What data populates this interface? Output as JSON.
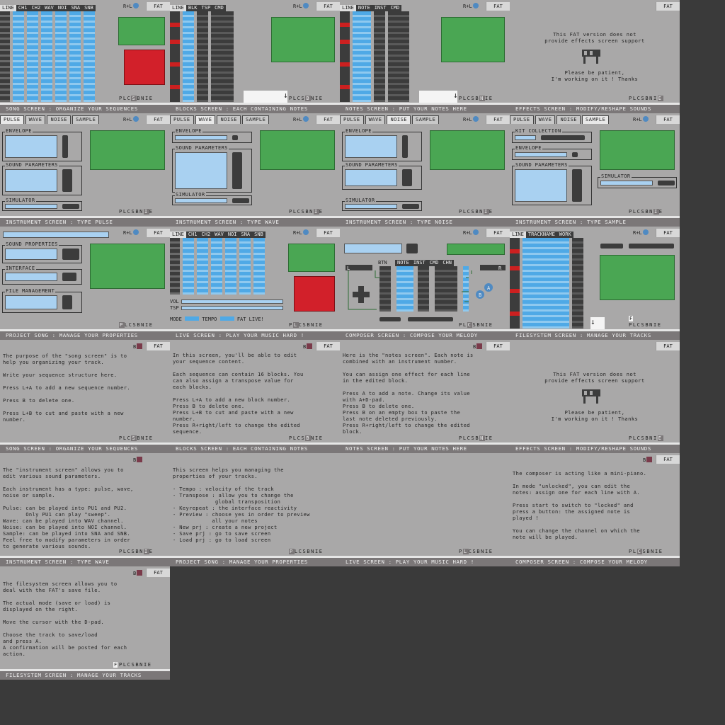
{
  "common": {
    "rl_label": "R+L",
    "b_label": "B",
    "fat_label": "FAT",
    "nav_letters": "PLCSBNIE",
    "nav_chars": [
      "P",
      "L",
      "C",
      "S",
      "B",
      "N",
      "I",
      "E"
    ]
  },
  "captions": {
    "song": "Song screen : organize your sequences",
    "blocks": "Blocks screen : each containing notes",
    "notes": "Notes screen : put your notes here",
    "effects": "Effects screen : modify/reshape sounds",
    "inst_pulse": "Instrument screen : type pulse",
    "inst_wave": "Instrument screen : type wave",
    "inst_noise": "Instrument screen : type noise",
    "inst_sample": "Instrument screen : type sample",
    "project": "Project song : manage your properties",
    "live": "Live screen : play your music hard !",
    "composer": "Composer screen : compose your melody",
    "filesystem": "Filesystem screen : manage your tracks"
  },
  "song_screen": {
    "headers": [
      "LINE",
      "CH1",
      "CH2",
      "WAV",
      "NOI",
      "SNA",
      "SNB"
    ]
  },
  "blocks_screen": {
    "headers": [
      "LINE",
      "BLK",
      "TSP",
      "CMD"
    ]
  },
  "notes_screen": {
    "headers": [
      "LINE",
      "NOTE",
      "INST",
      "CMD"
    ]
  },
  "effects_screen": {
    "line1": "This FAT version does not",
    "line2": "provide effects screen support",
    "line3": "Please be patient,",
    "line4": "I'm working on it ! Thanks"
  },
  "instrument_tabs": [
    "PULSE",
    "WAVE",
    "NOISE",
    "SAMPLE"
  ],
  "instrument_boxes": {
    "envelope": "ENVELOPE",
    "sound_parameters": "SOUND PARAMETERS",
    "simulator": "SIMULATOR",
    "kit_collection": "KIT COLLECTION"
  },
  "project_boxes": {
    "sound_properties": "SOUND PROPERTIES",
    "interface": "INTERFACE",
    "file_management": "FILE MANAGEMENT"
  },
  "live_screen": {
    "headers": [
      "LINE",
      "CH1",
      "CH2",
      "WAV",
      "NOI",
      "SNA",
      "SNB"
    ],
    "vol": "VOL",
    "tsp": "TSP",
    "mode": "MODE",
    "tempo": "TEMPO",
    "fat_live": "FAT LIVE!"
  },
  "composer_screen": {
    "btn": "BTN",
    "headers": [
      "NOTE",
      "INST",
      "CMD",
      "CHN"
    ],
    "l": "L",
    "r": "R",
    "a": "A",
    "b": "B"
  },
  "filesystem_screen": {
    "headers": [
      "LINE",
      "TRACKNAME",
      "WORK"
    ],
    "mode_letter": "F"
  },
  "help": {
    "song": "The purpose of the \"song screen\" is to\nhelp you organizing your track.\n\nWrite your sequence structure here.\n\nPress L+A to add a new sequence number.\n\nPress B to delete one.\n\nPress L+B to cut and paste with a new\nnumber.",
    "blocks": "In this screen, you'll be able to edit\nyour sequence content.\n\nEach sequence can contain 16 blocks. You\ncan also assign a transpose value for\neach blocks.\n\nPress L+A to add a new block number.\nPress B to delete one.\nPress L+B to cut and paste with a new\nnumber.\nPress R+right/left to change the edited\nsequence.",
    "notes": "Here is the \"notes screen\". Each note is\ncombined with an instrument number.\n\nYou can assign one effect for each line\nin the edited block.\n\nPress A to add a note. Change its value\nwith A+D-pad.\nPress B to delete one.\nPress B on an empty box to paste the\nlast note deleted previously.\nPress R+right/left to change the edited\nblock.",
    "instrument": "The \"instrument screen\" allows you to\nedit various sound parameters.\n\nEach instrument has a type: pulse, wave,\nnoise or sample.\n\nPulse: can be played into PU1 and PU2.\n       Only PU1 can play \"sweep\".\nWave: can be played into WAV channel.\nNoise: can be played into NOI channel.\nSample: can be played into SNA and SNB.\nFeel free to modify parameters in order\nto generate various sounds.",
    "project": "This screen helps you managing the\nproperties of your tracks.\n\n- Tempo : velocity of the track\n- Transpose : allow you to change the\n             global transposition\n- Keyrepeat : the interface reactivity\n- Preview : choose yes in order to preview\n            all your notes\n- New prj : create a new project\n- Save prj : go to save screen\n- Load prj : go to load screen",
    "composer": "The composer is acting like a mini-piano.\n\nIn mode \"unlocked\", you can edit the\nnotes: assign one for each line with A.\n\nPress start to switch to \"locked\" and\npress a button: the assigned note is\nplayed !\n\nYou can change the channel on which the\nnote will be played.",
    "filesystem": "The filesystem screen allows you to\ndeal with the FAT's save file.\n\nThe actual mode (save or load) is\ndisplayed on the right.\n\nMove the cursor with the D-pad.\n\nChoose the track to save/load\nand press A.\nA confirmation will be posted for each\naction."
  },
  "colors": {
    "panel": "#a9a8a8",
    "accent_blue": "#4fa9e6",
    "green": "#4aa653",
    "red": "#d2202a",
    "caption": "#7b7778"
  }
}
